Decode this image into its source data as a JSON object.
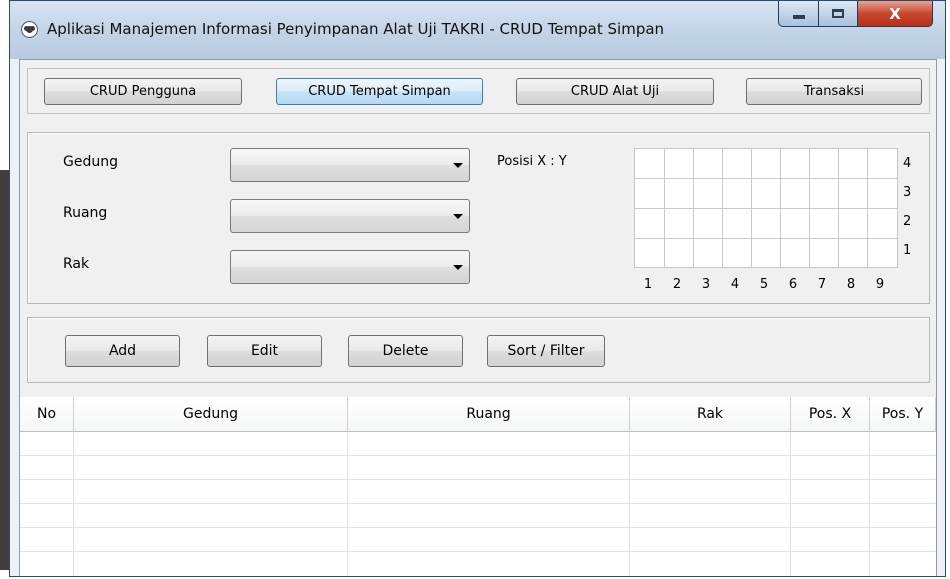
{
  "window": {
    "title": "Aplikasi Manajemen Informasi Penyimpanan Alat Uji TAKRI - CRUD Tempat Simpan",
    "controls": {
      "minimize_icon": "minimize-icon",
      "maximize_icon": "maximize-icon",
      "close_label": "X"
    }
  },
  "nav": {
    "pengguna": "CRUD Pengguna",
    "tempat_simpan": "CRUD Tempat Simpan",
    "alat_uji": "CRUD Alat Uji",
    "transaksi": "Transaksi"
  },
  "form": {
    "gedung_label": "Gedung",
    "ruang_label": "Ruang",
    "rak_label": "Rak",
    "gedung_value": "",
    "ruang_value": "",
    "rak_value": "",
    "posisi_label": "Posisi X : Y",
    "x_labels": [
      "1",
      "2",
      "3",
      "4",
      "5",
      "6",
      "7",
      "8",
      "9"
    ],
    "y_labels": [
      "4",
      "3",
      "2",
      "1"
    ]
  },
  "actions": {
    "add": "Add",
    "edit": "Edit",
    "delete": "Delete",
    "sort_filter": "Sort / Filter"
  },
  "table": {
    "columns": [
      "No",
      "Gedung",
      "Ruang",
      "Rak",
      "Pos. X",
      "Pos. Y"
    ],
    "rows": []
  },
  "colors": {
    "titlebar": "#c2d3e6",
    "focus_button": "#c5e2f7",
    "close_button": "#c8472d"
  }
}
